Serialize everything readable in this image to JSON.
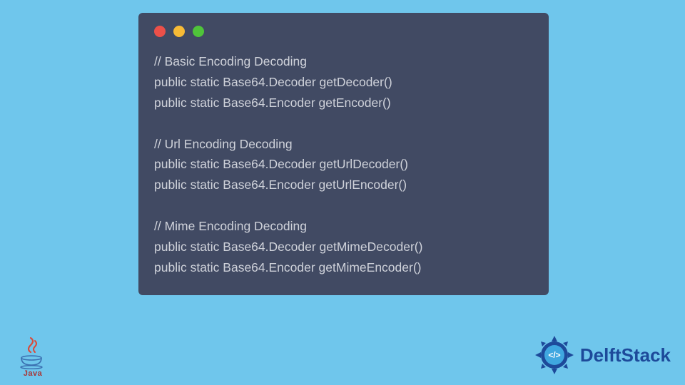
{
  "code": {
    "lines": [
      "// Basic Encoding Decoding",
      "public static Base64.Decoder getDecoder()",
      "public static Base64.Encoder getEncoder()",
      "",
      "// Url Encoding Decoding",
      "public static Base64.Decoder getUrlDecoder()",
      "public static Base64.Encoder getUrlEncoder()",
      "",
      "// Mime Encoding Decoding",
      "public static Base64.Decoder getMimeDecoder()",
      "public static Base64.Encoder getMimeEncoder()"
    ]
  },
  "branding": {
    "java_label": "Java",
    "delft_label": "DelftStack"
  }
}
